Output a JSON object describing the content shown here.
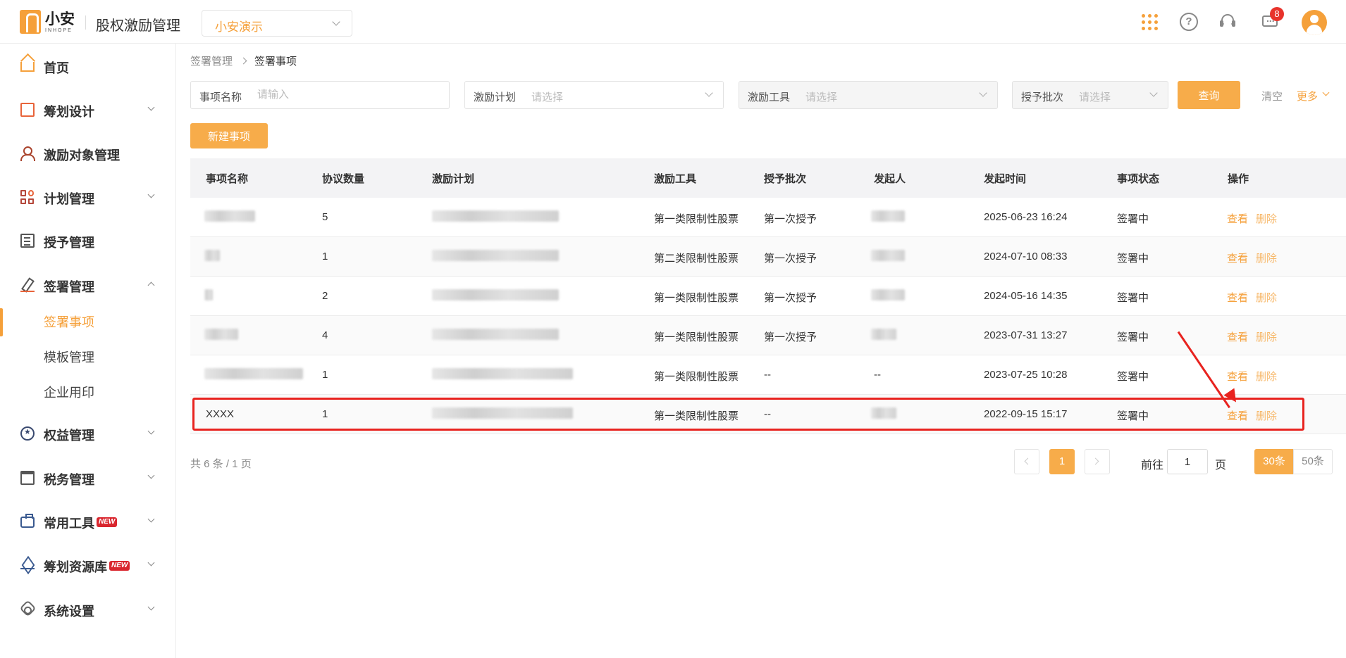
{
  "header": {
    "logo_cn": "小安",
    "logo_en": "INHOPE",
    "app_title": "股权激励管理",
    "company": "小安演示",
    "message_badge": "8",
    "accent_color": "#f5a03a"
  },
  "sidebar": {
    "items": [
      {
        "label": "首页",
        "icon": "home-icon"
      },
      {
        "label": "筹划设计",
        "icon": "edit-icon"
      },
      {
        "label": "激励对象管理",
        "icon": "user-icon"
      },
      {
        "label": "计划管理",
        "icon": "grid-icon"
      },
      {
        "label": "授予管理",
        "icon": "doc-icon"
      },
      {
        "label": "签署管理",
        "icon": "sign-icon",
        "sub": [
          "签署事项",
          "模板管理",
          "企业用印"
        ]
      },
      {
        "label": "权益管理",
        "icon": "equity-icon"
      },
      {
        "label": "税务管理",
        "icon": "tax-icon"
      },
      {
        "label": "常用工具",
        "icon": "toolbox-icon",
        "tag": "NEW"
      },
      {
        "label": "筹划资源库",
        "icon": "layers-icon",
        "tag": "NEW"
      },
      {
        "label": "系统设置",
        "icon": "gear-icon"
      }
    ]
  },
  "breadcrumb": [
    "签署管理",
    "签署事项"
  ],
  "filters": {
    "name_label": "事项名称",
    "name_placeholder": "请输入",
    "plan_label": "激励计划",
    "plan_placeholder": "请选择",
    "tool_label": "激励工具",
    "tool_placeholder": "请选择",
    "batch_label": "授予批次",
    "batch_placeholder": "请选择",
    "query": "查询",
    "clear": "清空",
    "more": "更多"
  },
  "new_button": "新建事项",
  "table": {
    "columns": [
      "事项名称",
      "协议数量",
      "激励计划",
      "激励工具",
      "授予批次",
      "发起人",
      "发起时间",
      "事项状态",
      "操作"
    ],
    "rows": [
      {
        "name": "",
        "count": "5",
        "tool": "第一类限制性股票",
        "batch": "第一次授予",
        "initiator": "",
        "time": "2025-06-23 16:24",
        "status": "签署中"
      },
      {
        "name": "",
        "count": "1",
        "tool": "第二类限制性股票",
        "batch": "第一次授予",
        "initiator": "",
        "time": "2024-07-10 08:33",
        "status": "签署中"
      },
      {
        "name": "",
        "count": "2",
        "tool": "第一类限制性股票",
        "batch": "第一次授予",
        "initiator": "",
        "time": "2024-05-16 14:35",
        "status": "签署中"
      },
      {
        "name": "",
        "count": "4",
        "tool": "第一类限制性股票",
        "batch": "第一次授予",
        "initiator": "",
        "time": "2023-07-31 13:27",
        "status": "签署中"
      },
      {
        "name": "",
        "count": "1",
        "tool": "第一类限制性股票",
        "batch": "--",
        "initiator": "--",
        "time": "2023-07-25 10:28",
        "status": "签署中"
      },
      {
        "name": "XXXX",
        "count": "1",
        "tool": "第一类限制性股票",
        "batch": "--",
        "initiator": "",
        "time": "2022-09-15 15:17",
        "status": "签署中"
      }
    ],
    "view": "查看",
    "delete": "删除"
  },
  "pagination": {
    "total": "共 6 条 / 1 页",
    "current": "1",
    "goto_label": "前往",
    "goto_value": "1",
    "page_unit": "页",
    "size_30": "30条",
    "size_50": "50条"
  }
}
